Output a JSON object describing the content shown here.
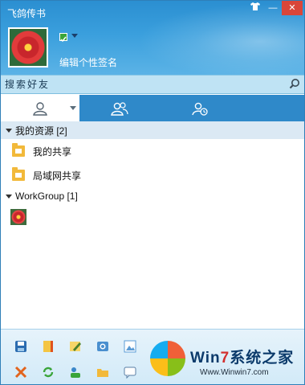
{
  "window": {
    "title": "飞鸽传书",
    "close_glyph": "✕",
    "min_glyph": "—",
    "skin_glyph": "👕"
  },
  "profile": {
    "signature_placeholder": "编辑个性签名"
  },
  "search": {
    "placeholder": "搜索好友"
  },
  "tabs": [
    {
      "name": "tab-contacts",
      "icon": "person-icon",
      "active": true
    },
    {
      "name": "tab-groups",
      "icon": "group-icon",
      "active": false
    },
    {
      "name": "tab-recent",
      "icon": "clock-person-icon",
      "active": false
    }
  ],
  "resources": {
    "group_label": "我的资源 [2]",
    "items": [
      "我的共享",
      "局域网共享"
    ]
  },
  "workgroup": {
    "group_label": "WorkGroup [1]"
  },
  "bottom_logo": {
    "brand_prefix": "Win",
    "brand_seven": "7",
    "brand_suffix": "系统之家",
    "url": "Www.Winwin7.com"
  },
  "colors": {
    "accent": "#2b8fd1",
    "tab_bar": "#2f89c9",
    "search_bg": "#bfe3f4",
    "folder": "#f2b93a"
  }
}
